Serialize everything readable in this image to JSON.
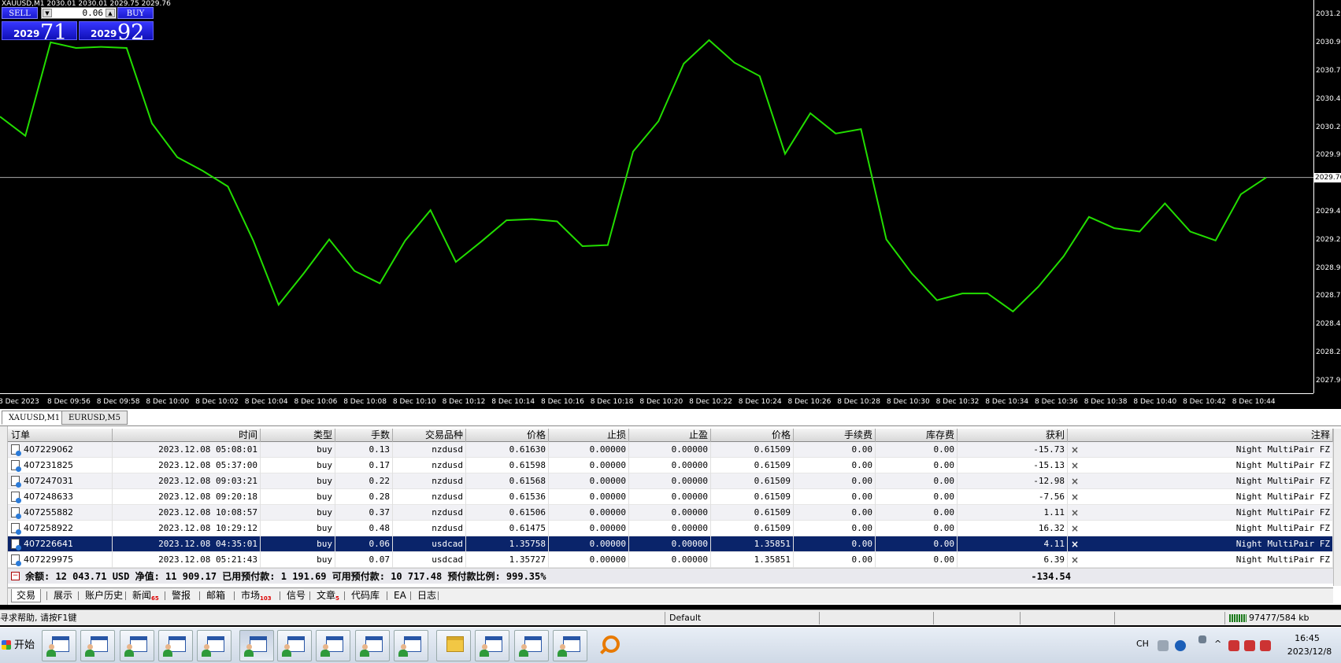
{
  "chart": {
    "title": "XAUUSD,M1  2030.01 2030.01 2029.75 2029.76",
    "price_ticks": [
      "2031.20",
      "2030.95",
      "2030.70",
      "2030.45",
      "2030.20",
      "2029.95",
      "2029.45",
      "2029.20",
      "2028.95",
      "2028.70",
      "2028.45",
      "2028.20",
      "2027.95"
    ],
    "current_price_label": "2029.76",
    "time_ticks": [
      "8 Dec 2023",
      "8 Dec 09:56",
      "8 Dec 09:58",
      "8 Dec 10:00",
      "8 Dec 10:02",
      "8 Dec 10:04",
      "8 Dec 10:06",
      "8 Dec 10:08",
      "8 Dec 10:10",
      "8 Dec 10:12",
      "8 Dec 10:14",
      "8 Dec 10:16",
      "8 Dec 10:18",
      "8 Dec 10:20",
      "8 Dec 10:22",
      "8 Dec 10:24",
      "8 Dec 10:26",
      "8 Dec 10:28",
      "8 Dec 10:30",
      "8 Dec 10:32",
      "8 Dec 10:34",
      "8 Dec 10:36",
      "8 Dec 10:38",
      "8 Dec 10:40",
      "8 Dec 10:42",
      "8 Dec 10:44"
    ],
    "line_color": "#22dd00",
    "ylim": [
      2027.9,
      2031.28
    ],
    "close_prices": [
      2030.3,
      2030.13,
      2030.96,
      2030.91,
      2030.92,
      2030.91,
      2030.24,
      2029.94,
      2029.82,
      2029.68,
      2029.2,
      2028.63,
      2028.91,
      2029.21,
      2028.93,
      2028.82,
      2029.2,
      2029.47,
      2029.01,
      2029.19,
      2029.38,
      2029.39,
      2029.37,
      2029.15,
      2029.16,
      2029.99,
      2030.26,
      2030.77,
      2030.98,
      2030.78,
      2030.66,
      2029.97,
      2030.33,
      2030.15,
      2030.19,
      2029.21,
      2028.91,
      2028.67,
      2028.73,
      2028.73,
      2028.57,
      2028.79,
      2029.06,
      2029.41,
      2029.31,
      2029.28,
      2029.53,
      2029.28,
      2029.2,
      2029.61,
      2029.76
    ]
  },
  "trade_panel": {
    "sell": "SELL",
    "buy": "BUY",
    "lot": "0.06",
    "bid_small": "2029",
    "bid_big": "71",
    "ask_small": "2029",
    "ask_big": "92"
  },
  "chart_tabs": [
    {
      "label": "XAUUSD,M1",
      "active": true
    },
    {
      "label": "EURUSD,M5",
      "active": false
    }
  ],
  "terminal": {
    "columns": [
      "订单",
      "时间",
      "类型",
      "手数",
      "交易品种",
      "价格",
      "止损",
      "止盈",
      "价格",
      "手续费",
      "库存费",
      "获利",
      "注释"
    ],
    "rows": [
      {
        "order": "407229062",
        "time": "2023.12.08 05:08:01",
        "type": "buy",
        "lots": "0.13",
        "symbol": "nzdusd",
        "price": "0.61630",
        "sl": "0.00000",
        "tp": "0.00000",
        "cur": "0.61509",
        "comm": "0.00",
        "swap": "0.00",
        "profit": "-15.73",
        "comment": "Night MultiPair FZ"
      },
      {
        "order": "407231825",
        "time": "2023.12.08 05:37:00",
        "type": "buy",
        "lots": "0.17",
        "symbol": "nzdusd",
        "price": "0.61598",
        "sl": "0.00000",
        "tp": "0.00000",
        "cur": "0.61509",
        "comm": "0.00",
        "swap": "0.00",
        "profit": "-15.13",
        "comment": "Night MultiPair FZ"
      },
      {
        "order": "407247031",
        "time": "2023.12.08 09:03:21",
        "type": "buy",
        "lots": "0.22",
        "symbol": "nzdusd",
        "price": "0.61568",
        "sl": "0.00000",
        "tp": "0.00000",
        "cur": "0.61509",
        "comm": "0.00",
        "swap": "0.00",
        "profit": "-12.98",
        "comment": "Night MultiPair FZ"
      },
      {
        "order": "407248633",
        "time": "2023.12.08 09:20:18",
        "type": "buy",
        "lots": "0.28",
        "symbol": "nzdusd",
        "price": "0.61536",
        "sl": "0.00000",
        "tp": "0.00000",
        "cur": "0.61509",
        "comm": "0.00",
        "swap": "0.00",
        "profit": "-7.56",
        "comment": "Night MultiPair FZ"
      },
      {
        "order": "407255882",
        "time": "2023.12.08 10:08:57",
        "type": "buy",
        "lots": "0.37",
        "symbol": "nzdusd",
        "price": "0.61506",
        "sl": "0.00000",
        "tp": "0.00000",
        "cur": "0.61509",
        "comm": "0.00",
        "swap": "0.00",
        "profit": "1.11",
        "comment": "Night MultiPair FZ"
      },
      {
        "order": "407258922",
        "time": "2023.12.08 10:29:12",
        "type": "buy",
        "lots": "0.48",
        "symbol": "nzdusd",
        "price": "0.61475",
        "sl": "0.00000",
        "tp": "0.00000",
        "cur": "0.61509",
        "comm": "0.00",
        "swap": "0.00",
        "profit": "16.32",
        "comment": "Night MultiPair FZ"
      },
      {
        "order": "407226641",
        "time": "2023.12.08 04:35:01",
        "type": "buy",
        "lots": "0.06",
        "symbol": "usdcad",
        "price": "1.35758",
        "sl": "0.00000",
        "tp": "0.00000",
        "cur": "1.35851",
        "comm": "0.00",
        "swap": "0.00",
        "profit": "4.11",
        "comment": "Night MultiPair FZ",
        "selected": true
      },
      {
        "order": "407229975",
        "time": "2023.12.08 05:21:43",
        "type": "buy",
        "lots": "0.07",
        "symbol": "usdcad",
        "price": "1.35727",
        "sl": "0.00000",
        "tp": "0.00000",
        "cur": "1.35851",
        "comm": "0.00",
        "swap": "0.00",
        "profit": "6.39",
        "comment": "Night MultiPair FZ"
      }
    ],
    "summary": "余额: 12 043.71 USD  净值: 11 909.17  已用预付款: 1 191.69  可用预付款: 10 717.48  预付款比例: 999.35%",
    "summary_total": "-134.54",
    "tabs": [
      {
        "label": "交易",
        "badge": "",
        "active": true
      },
      {
        "label": "展示",
        "badge": ""
      },
      {
        "label": "账户历史",
        "badge": ""
      },
      {
        "label": "新闻",
        "badge": "65"
      },
      {
        "label": "警报",
        "badge": ""
      },
      {
        "label": "邮箱",
        "badge": ""
      },
      {
        "label": "市场",
        "badge": "103"
      },
      {
        "label": "信号",
        "badge": ""
      },
      {
        "label": "文章",
        "badge": "5"
      },
      {
        "label": "代码库",
        "badge": ""
      },
      {
        "label": "EA",
        "badge": ""
      },
      {
        "label": "日志",
        "badge": ""
      }
    ]
  },
  "statusbar": {
    "help": "寻求帮助, 请按F1键",
    "profile": "Default",
    "traffic": "97477/584 kb"
  },
  "taskbar": {
    "start": "开始",
    "lang": "CH",
    "time": "16:45",
    "date": "2023/12/8"
  }
}
